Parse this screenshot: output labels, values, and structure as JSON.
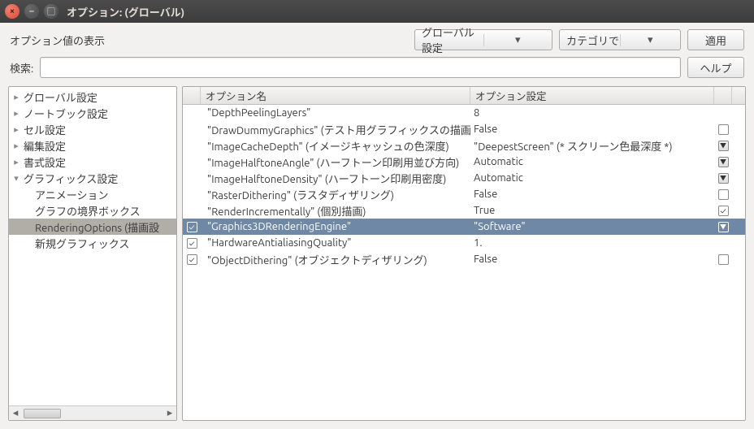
{
  "window": {
    "title": "オプション: (グローバル)"
  },
  "toolbar": {
    "display_label": "オプション値の表示",
    "scope_combo": "グローバル設定",
    "view_combo": "カテゴリで",
    "apply": "適用"
  },
  "search": {
    "label": "検索:",
    "value": ""
  },
  "help": "ヘルプ",
  "tree": {
    "items": [
      {
        "label": "グローバル設定",
        "depth": 0,
        "twist": "▸"
      },
      {
        "label": "ノートブック設定",
        "depth": 0,
        "twist": "▸"
      },
      {
        "label": "セル設定",
        "depth": 0,
        "twist": "▸"
      },
      {
        "label": "編集設定",
        "depth": 0,
        "twist": "▸"
      },
      {
        "label": "書式設定",
        "depth": 0,
        "twist": "▸"
      },
      {
        "label": "グラフィックス設定",
        "depth": 0,
        "twist": "▾"
      },
      {
        "label": "アニメーション",
        "depth": 1,
        "twist": ""
      },
      {
        "label": "グラフの境界ボックス",
        "depth": 1,
        "twist": ""
      },
      {
        "label": "RenderingOptions (描画設",
        "depth": 1,
        "twist": "",
        "selected": true
      },
      {
        "label": "新規グラフィックス",
        "depth": 1,
        "twist": ""
      }
    ]
  },
  "grid": {
    "header": {
      "name": "オプション名",
      "value": "オプション設定"
    },
    "rows": [
      {
        "name": "\"DepthPeelingLayers\"",
        "desc": "",
        "value": "8",
        "ctl": "none",
        "cb": null
      },
      {
        "name": "\"DrawDummyGraphics\"",
        "desc": " (テスト用グラフィックスの描画)",
        "value": "False",
        "ctl": "chk_off",
        "cb": null
      },
      {
        "name": "\"ImageCacheDepth\"",
        "desc": " (イメージキャッシュの色深度)",
        "value": "\"DeepestScreen\" (* スクリーン色最深度 *)",
        "ctl": "dd",
        "cb": null
      },
      {
        "name": "\"ImageHalftoneAngle\"",
        "desc": " (ハーフトーン印刷用並び方向)",
        "value": "Automatic",
        "ctl": "dd",
        "cb": null
      },
      {
        "name": "\"ImageHalftoneDensity\"",
        "desc": " (ハーフトーン印刷用密度)",
        "value": "Automatic",
        "ctl": "dd",
        "cb": null
      },
      {
        "name": "\"RasterDithering\"",
        "desc": " (ラスタディザリング)",
        "value": "False",
        "ctl": "chk_off",
        "cb": null
      },
      {
        "name": "\"RenderIncrementally\"",
        "desc": " (個別描画)",
        "value": "True",
        "ctl": "chk_on",
        "cb": null
      },
      {
        "name": "\"Graphics3DRenderingEngine\"",
        "desc": "",
        "value": "\"Software\"",
        "ctl": "dd",
        "cb": "on",
        "selected": true
      },
      {
        "name": "\"HardwareAntialiasingQuality\"",
        "desc": "",
        "value": "1.",
        "ctl": "none",
        "cb": "on"
      },
      {
        "name": "\"ObjectDithering\"",
        "desc": " (オブジェクトディザリング)",
        "value": "False",
        "ctl": "chk_off",
        "cb": "on"
      }
    ]
  }
}
